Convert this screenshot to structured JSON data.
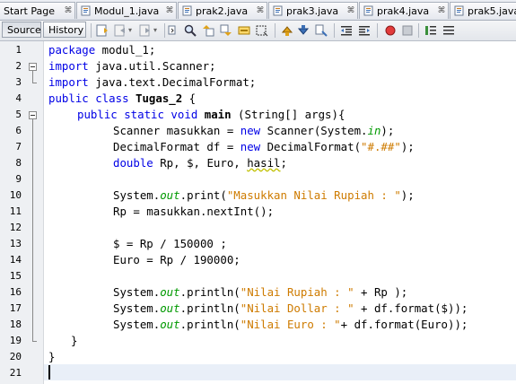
{
  "tabs": [
    {
      "label": "Start Page",
      "icon": "start-page-icon",
      "close": "⌘"
    },
    {
      "label": "Modul_1.java",
      "icon": "java-file-icon",
      "close": "⌘"
    },
    {
      "label": "prak2.java",
      "icon": "java-file-icon",
      "close": "⌘"
    },
    {
      "label": "prak3.java",
      "icon": "java-file-icon",
      "close": "⌘"
    },
    {
      "label": "prak4.java",
      "icon": "java-file-icon",
      "close": "⌘"
    },
    {
      "label": "prak5.java",
      "icon": "java-file-icon",
      "close": ""
    }
  ],
  "toolbar": {
    "source_label": "Source",
    "history_label": "History"
  },
  "line_numbers": [
    "1",
    "2",
    "3",
    "4",
    "5",
    "6",
    "7",
    "8",
    "9",
    "10",
    "11",
    "12",
    "13",
    "14",
    "15",
    "16",
    "17",
    "18",
    "19",
    "20",
    "21"
  ],
  "code": {
    "l1": {
      "kw": "package",
      "rest": " modul_1;"
    },
    "l2": {
      "kw": "import",
      "rest": " java.util.Scanner;"
    },
    "l3": {
      "kw": "import",
      "rest": " java.text.DecimalFormat;"
    },
    "l4": {
      "kw1": "public",
      "kw2": " class",
      "name": " Tugas_2",
      "rest": " {"
    },
    "l5": {
      "kw": "public static void",
      "name": " main",
      "rest": " (String[] args){"
    },
    "l6": {
      "a": "Scanner masukkan = ",
      "kw": "new",
      "b": " Scanner(System.",
      "fld": "in",
      "c": ");"
    },
    "l7": {
      "a": "DecimalFormat df = ",
      "kw": "new",
      "b": " DecimalFormat(",
      "str": "\"#.##\"",
      "c": ");"
    },
    "l8": {
      "kw": "double",
      "a": " Rp, $, Euro, ",
      "wavy": "hasil",
      "c": ";"
    },
    "l10": {
      "a": "System.",
      "fld": "out",
      "b": ".print(",
      "str": "\"Masukkan Nilai Rupiah : \"",
      "c": ");"
    },
    "l11": {
      "a": "Rp = masukkan.nextInt();"
    },
    "l13": {
      "a": "$ = Rp / 150000 ;"
    },
    "l14": {
      "a": "Euro = Rp / 190000;"
    },
    "l16": {
      "a": "System.",
      "fld": "out",
      "b": ".println(",
      "str": "\"Nilai Rupiah : \"",
      "c": " + Rp );"
    },
    "l17": {
      "a": "System.",
      "fld": "out",
      "b": ".println(",
      "str": "\"Nilai Dollar : \"",
      "c": " + df.format($));"
    },
    "l18": {
      "a": "System.",
      "fld": "out",
      "b": ".println(",
      "str": "\"Nilai Euro : \"",
      "c": "+ df.format(Euro));"
    },
    "l19": {
      "a": "}"
    },
    "l20": {
      "a": "}"
    }
  },
  "colors": {
    "keyword": "#0000e6",
    "string": "#ce7b00",
    "field": "#009900"
  }
}
